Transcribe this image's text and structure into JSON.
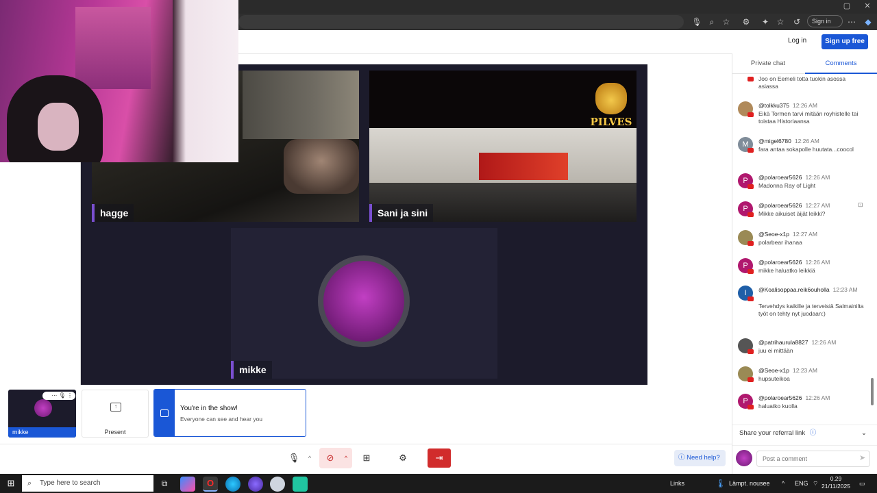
{
  "browser": {
    "signin_label": "Sign in",
    "window_buttons": [
      "—",
      "▢",
      "✕"
    ]
  },
  "header": {
    "login_label": "Log in",
    "signup_label": "Sign up free"
  },
  "stage": {
    "participants": [
      {
        "name": "hagge"
      },
      {
        "name": "Sani ja sini",
        "overlay_logo_text": "PILVES"
      },
      {
        "name": "mikke"
      }
    ]
  },
  "self_tile": {
    "label": "mikke"
  },
  "present": {
    "label": "Present"
  },
  "toast": {
    "title": "You're in the show!",
    "subtitle": "Everyone can see and hear you"
  },
  "controls": {
    "help_label": "Need help?"
  },
  "sidebar": {
    "tabs": [
      {
        "label": "Private chat"
      },
      {
        "label": "Comments",
        "active": true
      }
    ],
    "comments": [
      {
        "author": "",
        "time": "",
        "text": "Joo on Eemeli totta tuokin asossa asiassa",
        "avatar_letter": "",
        "avatar_color": "#ffffff"
      },
      {
        "author": "@tolkku375",
        "time": "12:26 AM",
        "text": "Eikä Tormen tarvi mitään royhistelle tai toistaa Historiaansa",
        "avatar_letter": "",
        "avatar_color": "#b08a5a"
      },
      {
        "author": "@migel6780",
        "time": "12:26 AM",
        "text": "fara antaa sokapolle huutata...coocol",
        "avatar_letter": "M",
        "avatar_color": "#7f8c99"
      },
      {
        "author": "@polaroear5626",
        "time": "12:26 AM",
        "text": "Madonna Ray of Light",
        "avatar_letter": "P",
        "avatar_color": "#b0186e"
      },
      {
        "author": "@polaroear5626",
        "time": "12:27 AM",
        "text": "Mikke aikuiset äijät leikki?",
        "avatar_letter": "P",
        "avatar_color": "#b0186e"
      },
      {
        "author": "@Seoe-x1p",
        "time": "12:27 AM",
        "text": "polarbear ihanaa",
        "avatar_letter": "",
        "avatar_color": "#9a8a55"
      },
      {
        "author": "@polaroear5626",
        "time": "12:26 AM",
        "text": "mikke haluatko leikkiä",
        "avatar_letter": "P",
        "avatar_color": "#b0186e"
      },
      {
        "author": "@Koalisoppaa.reik6ouholla",
        "time": "12:23 AM",
        "text": "Tervehdys kaikille ja terveisiä Salmainilta työt on tehty nyt juodaan:)",
        "avatar_letter": "I",
        "avatar_color": "#1f5fa8"
      },
      {
        "author": "@patrihaurula8827",
        "time": "12:26 AM",
        "text": "juu ei mittään",
        "avatar_letter": "",
        "avatar_color": "#555555"
      },
      {
        "author": "@Seoe-x1p",
        "time": "12:23 AM",
        "text": "hupsuteikoa",
        "avatar_letter": "",
        "avatar_color": "#9a8a55"
      },
      {
        "author": "@polaroear5626",
        "time": "12:26 AM",
        "text": "haluatko kuolla",
        "avatar_letter": "P",
        "avatar_color": "#b0186e"
      }
    ],
    "referral_label": "Share your referral link",
    "post_placeholder": "Post a comment"
  },
  "taskbar": {
    "search_placeholder": "Type here to search",
    "links_label": "Links",
    "weather_label": "Lämpt. nousee",
    "language": "ENG",
    "time": "0.29",
    "date": "21/11/2025"
  },
  "colors": {
    "accent": "#1a57d6",
    "stage_bg": "#1c1b2b",
    "leave": "#d12c2c",
    "name_tag_bar": "#7a4fd0"
  }
}
